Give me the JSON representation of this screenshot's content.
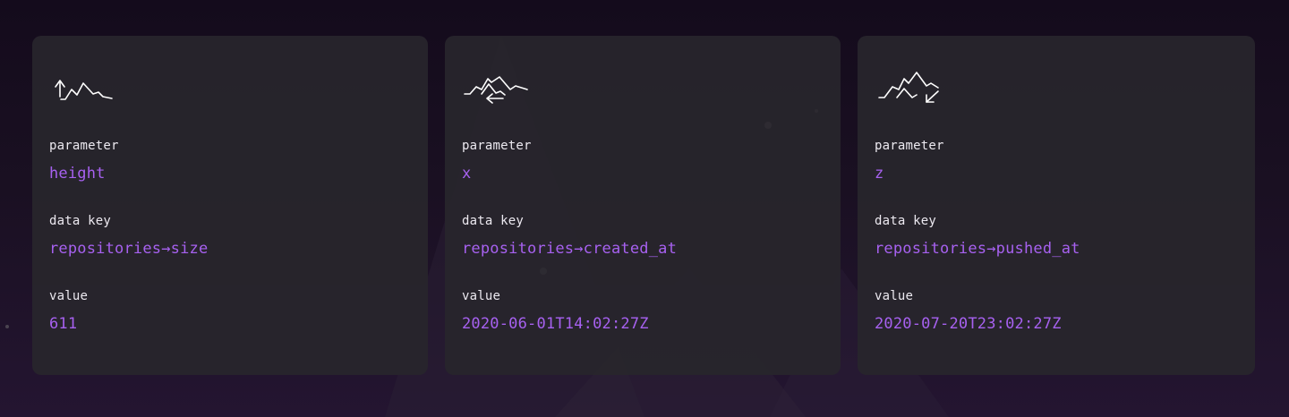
{
  "cards": [
    {
      "icon": "mountain-arrow-up-icon",
      "param_label": "parameter",
      "param_value": "height",
      "key_label": "data key",
      "key_value": "repositories→size",
      "value_label": "value",
      "value_value": "611"
    },
    {
      "icon": "mountain-arrow-left-icon",
      "param_label": "parameter",
      "param_value": "x",
      "key_label": "data key",
      "key_value": "repositories→created_at",
      "value_label": "value",
      "value_value": "2020-06-01T14:02:27Z"
    },
    {
      "icon": "mountain-arrow-down-left-icon",
      "param_label": "parameter",
      "param_value": "z",
      "key_label": "data key",
      "key_value": "repositories→pushed_at",
      "value_label": "value",
      "value_value": "2020-07-20T23:02:27Z"
    }
  ],
  "colors": {
    "background": "#1a1022",
    "card": "#28262c",
    "label": "#ece9f0",
    "accent": "#a761f0"
  }
}
